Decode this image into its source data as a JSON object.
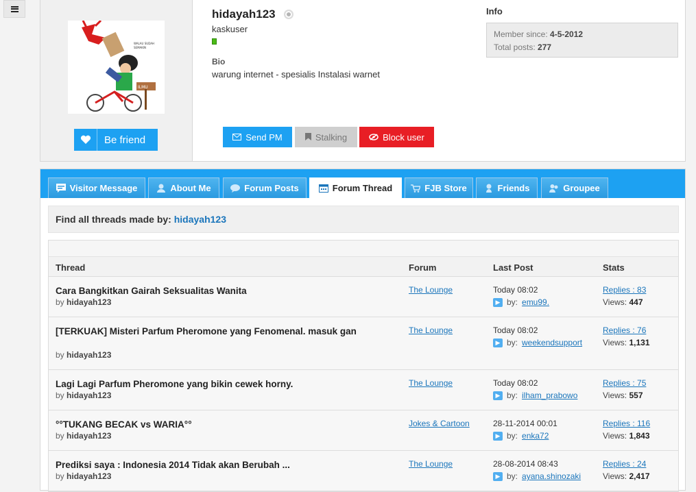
{
  "menu": {
    "icon": "hamburger-icon"
  },
  "profile": {
    "username": "hidayah123",
    "user_title": "kaskuser",
    "bio_heading": "Bio",
    "bio_text": "warung internet - spesialis Instalasi warnet",
    "befriend_label": "Be friend",
    "buttons": {
      "send_pm": "Send PM",
      "stalking": "Stalking",
      "block": "Block user"
    },
    "info": {
      "heading": "Info",
      "member_since_label": "Member since:",
      "member_since": "4-5-2012",
      "total_posts_label": "Total posts:",
      "total_posts": "277"
    },
    "colors": {
      "primary": "#1da1f2",
      "danger": "#e81e25",
      "disabled": "#cfcfcf",
      "reputation": "#4cbb17"
    }
  },
  "tabs": [
    {
      "label": "Visitor Message",
      "icon": "message-icon"
    },
    {
      "label": "About Me",
      "icon": "user-icon"
    },
    {
      "label": "Forum Posts",
      "icon": "chat-icon"
    },
    {
      "label": "Forum Thread",
      "icon": "calendar-icon",
      "active": true
    },
    {
      "label": "FJB Store",
      "icon": "cart-icon"
    },
    {
      "label": "Friends",
      "icon": "friends-icon"
    },
    {
      "label": "Groupee",
      "icon": "group-icon"
    }
  ],
  "find": {
    "prefix": "Find all threads made by:",
    "user": "hidayah123"
  },
  "table": {
    "headers": {
      "thread": "Thread",
      "forum": "Forum",
      "last_post": "Last Post",
      "stats": "Stats"
    },
    "rows": [
      {
        "title": "Cara Bangkitkan Gairah Seksualitas Wanita",
        "by_label": "by",
        "author": "hidayah123",
        "forum": "The Lounge",
        "time": "Today 08:02",
        "last_by_label": "by:",
        "last_user": "emu99.",
        "replies": "Replies : 83",
        "views_label": "Views:",
        "views": "447"
      },
      {
        "title": "[TERKUAK] Misteri Parfum Pheromone yang Fenomenal. masuk gan",
        "by_label": "by",
        "author": "hidayah123",
        "forum": "The Lounge",
        "time": "Today 08:02",
        "last_by_label": "by:",
        "last_user": "weekendsupport",
        "replies": "Replies : 76",
        "views_label": "Views:",
        "views": "1,131"
      },
      {
        "title": "Lagi Lagi Parfum Pheromone yang bikin cewek horny.",
        "by_label": "by",
        "author": "hidayah123",
        "forum": "The Lounge",
        "time": "Today 08:02",
        "last_by_label": "by:",
        "last_user": "ilham_prabowo",
        "replies": "Replies : 75",
        "views_label": "Views:",
        "views": "557"
      },
      {
        "title": "°°TUKANG BECAK vs WARIA°°",
        "by_label": "by",
        "author": "hidayah123",
        "forum": "Jokes & Cartoon",
        "time": "28-11-2014 00:01",
        "last_by_label": "by:",
        "last_user": "enka72",
        "replies": "Replies : 116",
        "views_label": "Views:",
        "views": "1,843"
      },
      {
        "title": "Prediksi saya : Indonesia 2014 Tidak akan Berubah ...",
        "by_label": "by",
        "author": "hidayah123",
        "forum": "The Lounge",
        "time": "28-08-2014 08:43",
        "last_by_label": "by:",
        "last_user": "ayana.shinozaki",
        "replies": "Replies : 24",
        "views_label": "Views:",
        "views": "2,417"
      }
    ]
  }
}
